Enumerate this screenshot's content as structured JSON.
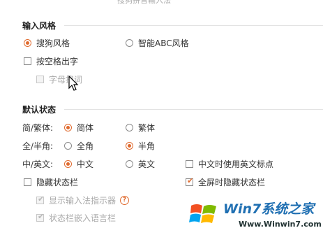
{
  "window_title": "搜狗拼音输入法",
  "sections": {
    "input_style": {
      "title": "输入风格",
      "radio_sougou": "搜狗风格",
      "radio_abc": "智能ABC风格",
      "selected": "搜狗风格",
      "checkbox_space_output": "按空格出字",
      "checkbox_space_output_checked": false,
      "checkbox_letter_search": "字母搜词",
      "checkbox_letter_search_disabled": true
    },
    "default_state": {
      "title": "默认状态",
      "row_simp_trad": {
        "label": "简/繁体:",
        "option_simp": "简体",
        "option_trad": "繁体",
        "selected": "简体"
      },
      "row_width": {
        "label": "全/半角:",
        "option_full": "全角",
        "option_half": "半角",
        "selected": "半角"
      },
      "row_lang": {
        "label": "中/英文:",
        "option_cn": "中文",
        "option_en": "英文",
        "selected": "中文",
        "checkbox_en_punct": "中文时使用英文标点",
        "checkbox_en_punct_checked": false
      },
      "checkbox_hide_status": "隐藏状态栏",
      "checkbox_hide_status_checked": false,
      "checkbox_fullscreen_hide": "全屏时隐藏状态栏",
      "checkbox_fullscreen_hide_checked": true,
      "checkbox_show_indicator": "显示输入法指示器",
      "checkbox_show_indicator_checked": true,
      "checkbox_show_indicator_disabled": true,
      "help_symbol": "?",
      "checkbox_embed_lang": "状态栏嵌入语言栏",
      "checkbox_embed_lang_checked": true,
      "checkbox_embed_lang_disabled": true
    }
  },
  "watermark": {
    "brand": "Win7系统之家",
    "url": "Www.Winwin7.com"
  },
  "colors": {
    "accent": "#e06a2e",
    "watermark_blue": "#1f6fb2"
  }
}
